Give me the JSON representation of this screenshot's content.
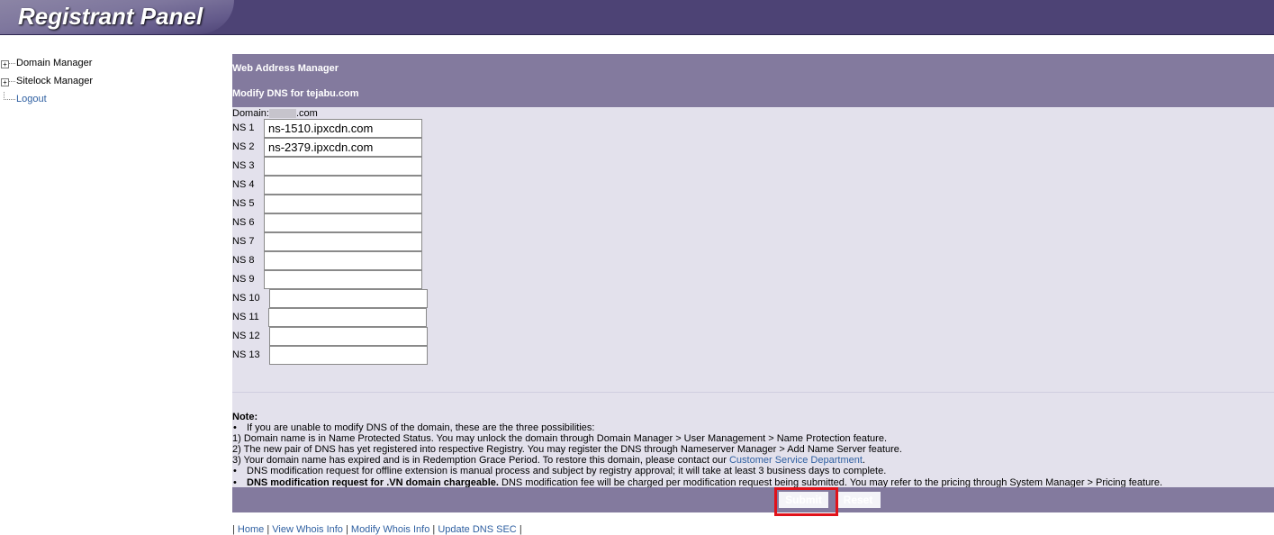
{
  "header": {
    "title": "Registrant Panel"
  },
  "tree": {
    "items": [
      {
        "label": "Domain Manager",
        "expandable": true
      },
      {
        "label": "Sitelock Manager",
        "expandable": true
      },
      {
        "label": "Logout",
        "expandable": false
      }
    ]
  },
  "panel": {
    "section_title": "Web Address Manager",
    "form_title": "Modify DNS for tejabu.com",
    "domain_label": "Domain:",
    "domain_suffix": ".com",
    "ns": [
      {
        "label": "NS 1",
        "value": "ns-1510.ipxcdn.com"
      },
      {
        "label": "NS 2",
        "value": "ns-2379.ipxcdn.com"
      },
      {
        "label": "NS 3",
        "value": ""
      },
      {
        "label": "NS 4",
        "value": ""
      },
      {
        "label": "NS 5",
        "value": ""
      },
      {
        "label": "NS 6",
        "value": ""
      },
      {
        "label": "NS 7",
        "value": ""
      },
      {
        "label": "NS 8",
        "value": ""
      },
      {
        "label": "NS 9",
        "value": ""
      },
      {
        "label": "NS 10",
        "value": ""
      },
      {
        "label": "NS 11",
        "value": ""
      },
      {
        "label": "NS 12",
        "value": ""
      },
      {
        "label": "NS 13",
        "value": ""
      }
    ],
    "note": {
      "title": "Note:",
      "bullet1": "If you are unable to modify DNS of the domain, these are the three possibilities:",
      "p1": "1) Domain name is in Name Protected Status. You may unlock the domain through Domain Manager > User Management > Name Protection feature.",
      "p2": "2) The new pair of DNS has yet registered into respective Registry. You may register the DNS through Nameserver Manager > Add Name Server feature.",
      "p3_text": "3) Your domain name has expired and is in Redemption Grace Period. To restore this domain, please contact our ",
      "p3_link": "Customer Service Department",
      "p3_end": ".",
      "bullet2": "DNS modification request for offline extension is manual process and subject by registry approval; it will take at least 3 business days to complete.",
      "bullet3_bold": "DNS modification request for .VN domain chargeable.",
      "bullet3_rest": " DNS modification fee will be charged per modification request being submitted. You may refer to the pricing through System Manager > Pricing feature."
    },
    "buttons": {
      "submit": "Submit",
      "reset": "Reset"
    }
  },
  "footer_links": {
    "sep": "|",
    "home": "Home",
    "view_whois": "View Whois Info",
    "modify_whois": "Modify Whois Info",
    "update_dns_sec": "Update DNS SEC"
  },
  "colors": {
    "header_bg": "#4d4375",
    "panel_band": "#837a9e",
    "panel_body": "#e3e1ec",
    "link": "#2e5fa1",
    "highlight": "#e0121a"
  }
}
